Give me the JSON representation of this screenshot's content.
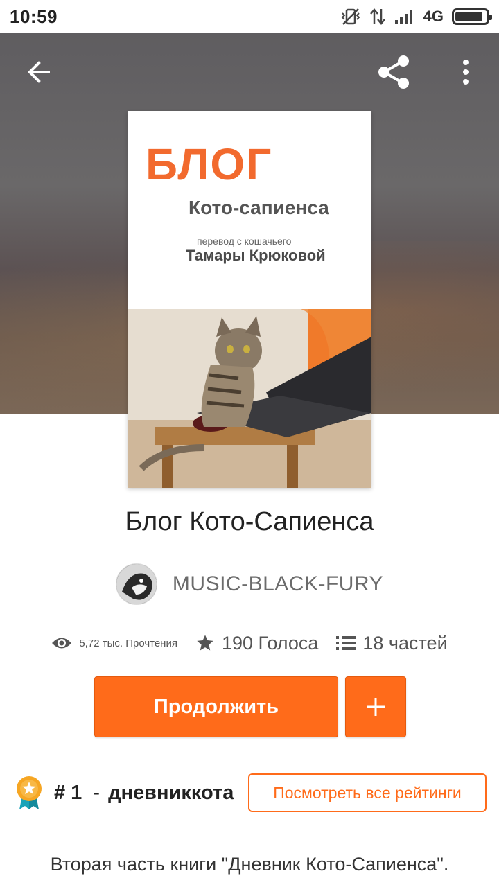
{
  "status_bar": {
    "time": "10:59",
    "network": "4G",
    "icons": [
      "vibrate-off-icon",
      "data-transfer-icon",
      "signal-icon",
      "battery-icon"
    ],
    "battery_level": 0.9
  },
  "toolbar": {
    "icons": [
      "back-arrow-icon",
      "share-icon",
      "more-vert-icon"
    ]
  },
  "cover": {
    "title": "БЛОГ",
    "subtitle": "Кото-сапиенса",
    "translation_note": "перевод с кошачьего",
    "author": "Тамары Крюковой"
  },
  "story": {
    "title": "Блог Кото-Сапиенса",
    "author": "MUSIC-BLACK-FURY",
    "reads": "5,72 тыс. Прочтения",
    "votes": "190 Голоса",
    "parts": "18 частей"
  },
  "actions": {
    "continue_label": "Продолжить",
    "add_icon": "plus-icon"
  },
  "ranking": {
    "rank": "# 1",
    "separator": "-",
    "tag": "дневниккота",
    "view_all_label": "Посмотреть все рейтинги"
  },
  "description": "Вторая часть книги \"Дневник Кото-Сапиенса\".",
  "colors": {
    "accent": "#ff6b1a",
    "cover_title": "#f26a2e"
  }
}
